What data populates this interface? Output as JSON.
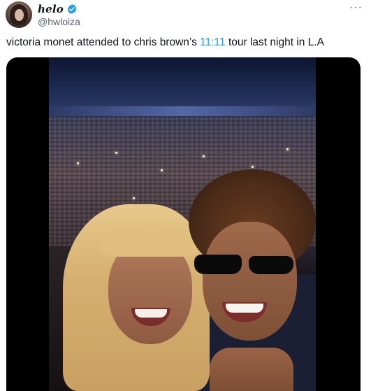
{
  "tweet": {
    "author": {
      "display_name": "helo",
      "handle": "@hwloiza",
      "verified": true
    },
    "more_label": "···",
    "text_before": "victoria monet attended to chris brown’s ",
    "text_link": "11:11",
    "text_after": " tour last night in L.A",
    "colors": {
      "link": "#1d9bf0",
      "text": "#0f1419",
      "secondary": "#536471",
      "verified": "#1d9bf0"
    }
  },
  "media": {
    "type": "video-thumbnail"
  }
}
